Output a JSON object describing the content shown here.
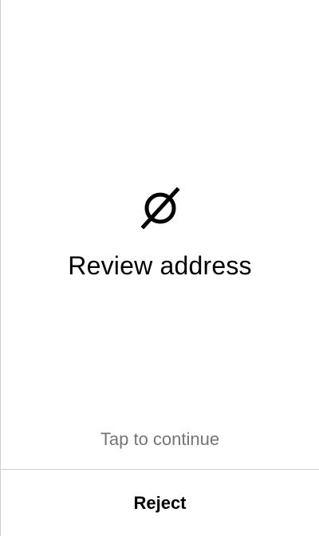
{
  "screen": {
    "icon": "empty-set-icon",
    "title": "Review address",
    "tap_hint": "Tap to continue",
    "reject_label": "Reject"
  },
  "colors": {
    "background": "#ffffff",
    "text": "#000000",
    "hint": "#757575",
    "divider": "#cfcfcf"
  }
}
